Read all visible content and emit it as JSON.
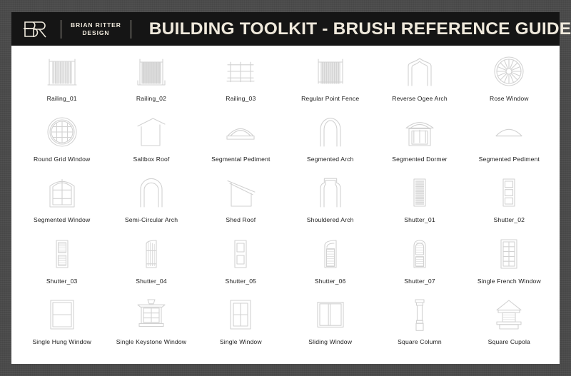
{
  "header": {
    "logo_name": "brian-ritter-design-monogram",
    "brand_line1": "BRIAN RITTER",
    "brand_line2": "DESIGN",
    "title": "BUILDING TOOLKIT - BRUSH REFERENCE GUIDE",
    "bar_color": "#151515",
    "text_color": "#efe9dc"
  },
  "sheet": {
    "background": "#ffffff",
    "mat_color": "#4b4b4b",
    "line_color": "#d8d8d8"
  },
  "items": [
    {
      "label": "Railing_01",
      "icon": "railing-01-icon"
    },
    {
      "label": "Railing_02",
      "icon": "railing-02-icon"
    },
    {
      "label": "Railing_03",
      "icon": "railing-03-icon"
    },
    {
      "label": "Regular Point Fence",
      "icon": "regular-point-fence-icon"
    },
    {
      "label": "Reverse Ogee Arch",
      "icon": "reverse-ogee-arch-icon"
    },
    {
      "label": "Rose Window",
      "icon": "rose-window-icon"
    },
    {
      "label": "Round Grid Window",
      "icon": "round-grid-window-icon"
    },
    {
      "label": "Saltbox Roof",
      "icon": "saltbox-roof-icon"
    },
    {
      "label": "Segmental Pediment",
      "icon": "segmental-pediment-icon"
    },
    {
      "label": "Segmented Arch",
      "icon": "segmented-arch-icon"
    },
    {
      "label": "Segmented Dormer",
      "icon": "segmented-dormer-icon"
    },
    {
      "label": "Segmented Pediment",
      "icon": "segmented-pediment-icon"
    },
    {
      "label": "Segmented Window",
      "icon": "segmented-window-icon"
    },
    {
      "label": "Semi-Circular Arch",
      "icon": "semi-circular-arch-icon"
    },
    {
      "label": "Shed Roof",
      "icon": "shed-roof-icon"
    },
    {
      "label": "Shouldered Arch",
      "icon": "shouldered-arch-icon"
    },
    {
      "label": "Shutter_01",
      "icon": "shutter-01-icon"
    },
    {
      "label": "Shutter_02",
      "icon": "shutter-02-icon"
    },
    {
      "label": "Shutter_03",
      "icon": "shutter-03-icon"
    },
    {
      "label": "Shutter_04",
      "icon": "shutter-04-icon"
    },
    {
      "label": "Shutter_05",
      "icon": "shutter-05-icon"
    },
    {
      "label": "Shutter_06",
      "icon": "shutter-06-icon"
    },
    {
      "label": "Shutter_07",
      "icon": "shutter-07-icon"
    },
    {
      "label": "Single French Window",
      "icon": "single-french-window-icon"
    },
    {
      "label": "Single Hung Window",
      "icon": "single-hung-window-icon"
    },
    {
      "label": "Single Keystone Window",
      "icon": "single-keystone-window-icon"
    },
    {
      "label": "Single Window",
      "icon": "single-window-icon"
    },
    {
      "label": "Sliding Window",
      "icon": "sliding-window-icon"
    },
    {
      "label": "Square Column",
      "icon": "square-column-icon"
    },
    {
      "label": "Square Cupola",
      "icon": "square-cupola-icon"
    }
  ]
}
